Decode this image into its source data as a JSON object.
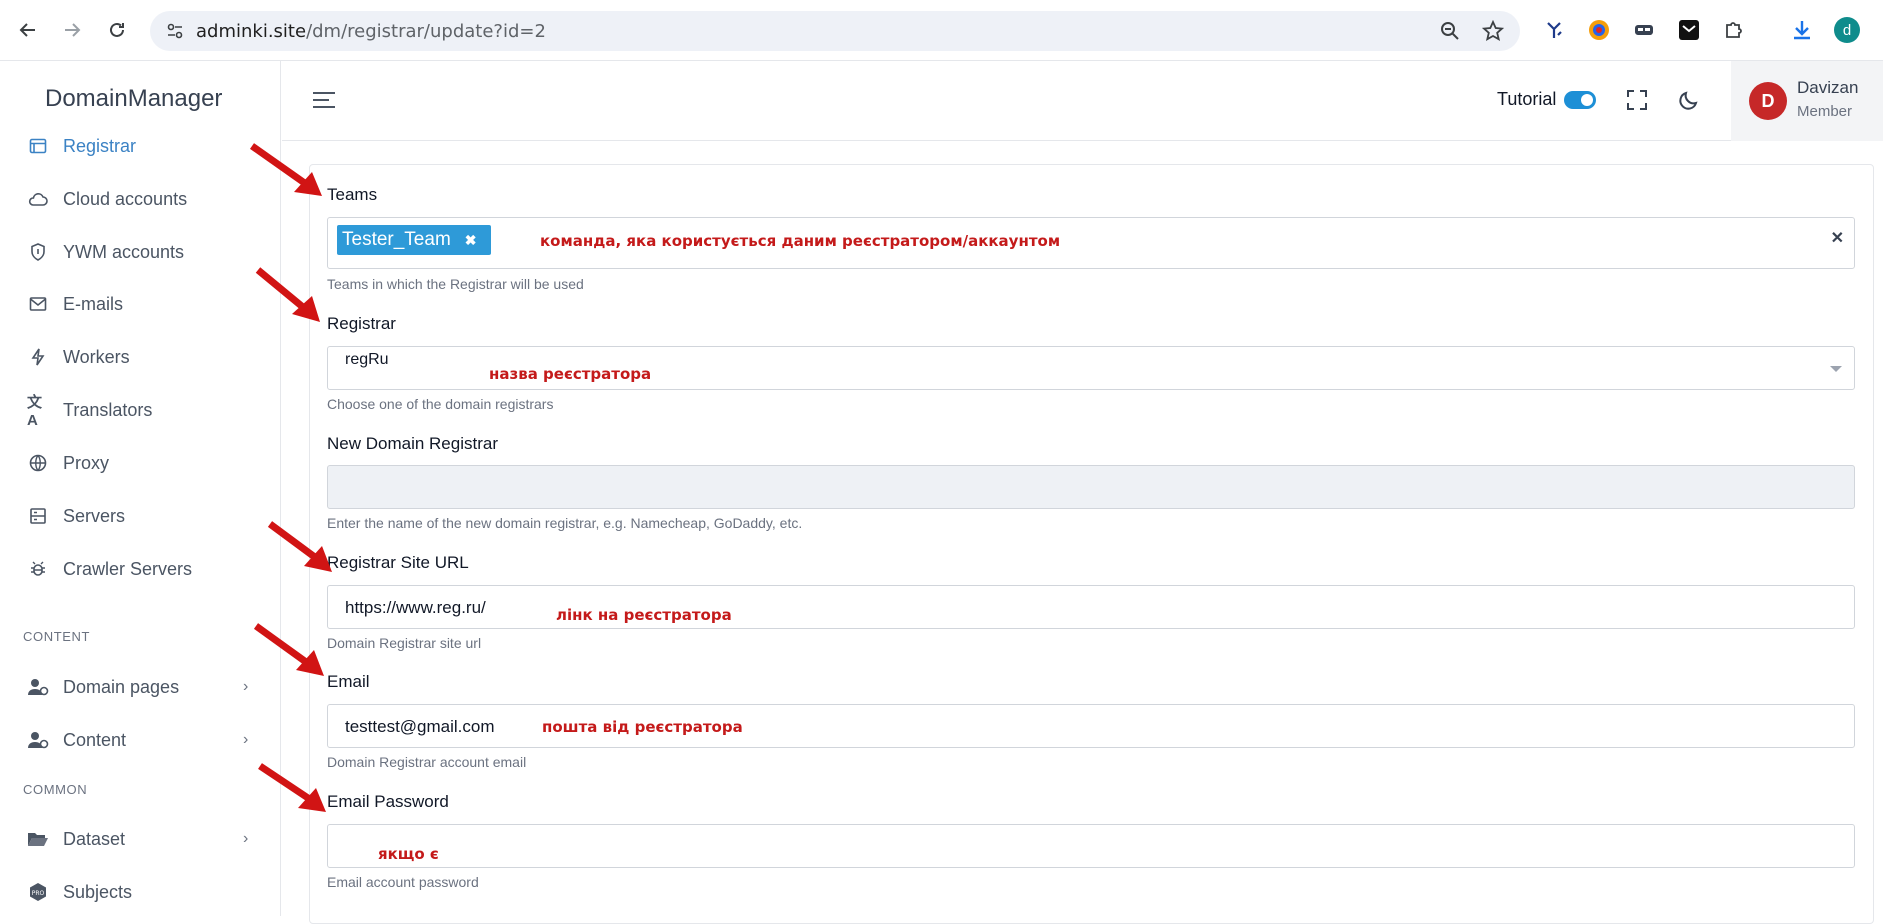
{
  "browser": {
    "url_host": "adminki.site",
    "url_path": "/dm/registrar/update?id=2",
    "profile_initial": "d"
  },
  "sidebar": {
    "brand": "DomainManager",
    "items": [
      {
        "label": "Registrar",
        "icon": "browser-window-icon"
      },
      {
        "label": "Cloud accounts",
        "icon": "cloud-icon"
      },
      {
        "label": "YWM accounts",
        "icon": "shield-icon"
      },
      {
        "label": "E-mails",
        "icon": "mail-icon"
      },
      {
        "label": "Workers",
        "icon": "lightning-icon"
      },
      {
        "label": "Translators",
        "icon": "translate-icon"
      },
      {
        "label": "Proxy",
        "icon": "globe-icon"
      },
      {
        "label": "Servers",
        "icon": "server-icon"
      },
      {
        "label": "Crawler Servers",
        "icon": "bug-icon"
      }
    ],
    "section_content": "CONTENT",
    "content_items": [
      {
        "label": "Domain pages",
        "icon": "users-gear-icon"
      },
      {
        "label": "Content",
        "icon": "users-gear-icon"
      }
    ],
    "section_common": "COMMON",
    "common_items": [
      {
        "label": "Dataset",
        "icon": "folder-open-icon"
      },
      {
        "label": "Subjects",
        "icon": "pro-badge-icon"
      }
    ]
  },
  "header": {
    "tutorial_label": "Tutorial",
    "tutorial_on": true,
    "user_initial": "D",
    "user_name": "Davizan",
    "user_role": "Member"
  },
  "form": {
    "teams": {
      "label": "Teams",
      "chip": "Tester_Team",
      "chip_remove": "✖",
      "clear": "✕",
      "help": "Teams in which the Registrar will be used",
      "note": "команда, яка користується даним реєстратором/аккаунтом"
    },
    "registrar": {
      "label": "Registrar",
      "value": "regRu",
      "help": "Choose one of the domain registrars",
      "note": "назва реєстратора"
    },
    "new_registrar": {
      "label": "New Domain Registrar",
      "value": "",
      "help": "Enter the name of the new domain registrar, e.g. Namecheap, GoDaddy, etc."
    },
    "site_url": {
      "label": "Registrar Site URL",
      "value": "https://www.reg.ru/",
      "help": "Domain Registrar site url",
      "note": "лінк на реєстратора"
    },
    "email": {
      "label": "Email",
      "value": "testtest@gmail.com",
      "help": "Domain Registrar account email",
      "note": "пошта від реєстратора"
    },
    "email_password": {
      "label": "Email Password",
      "value": "",
      "help": "Email account password",
      "note": "якщо є"
    }
  },
  "colors": {
    "accent": "#2e9ad8",
    "annotation": "#c41a1a",
    "avatar": "#c62828"
  }
}
